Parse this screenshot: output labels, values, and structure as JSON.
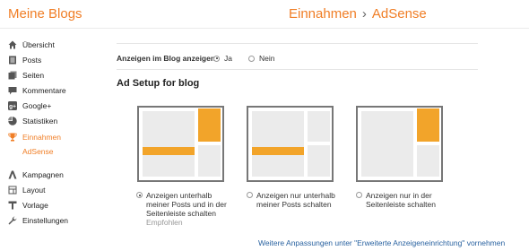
{
  "header": {
    "brand": "Meine Blogs",
    "breadcrumb_section": "Einnahmen",
    "breadcrumb_separator": "›",
    "breadcrumb_page": "AdSense"
  },
  "sidebar": {
    "items": [
      {
        "label": "Übersicht",
        "icon": "home-icon"
      },
      {
        "label": "Posts",
        "icon": "document-icon"
      },
      {
        "label": "Seiten",
        "icon": "pages-icon"
      },
      {
        "label": "Kommentare",
        "icon": "comment-icon"
      },
      {
        "label": "Google+",
        "icon": "google-plus-icon"
      },
      {
        "label": "Statistiken",
        "icon": "pie-chart-icon"
      },
      {
        "label": "Einnahmen",
        "icon": "trophy-icon",
        "active": true
      },
      {
        "label": "AdSense",
        "sub": true
      },
      {
        "label": "Kampagnen",
        "icon": "campaign-icon"
      },
      {
        "label": "Layout",
        "icon": "layout-icon"
      },
      {
        "label": "Vorlage",
        "icon": "template-icon"
      },
      {
        "label": "Einstellungen",
        "icon": "wrench-icon"
      }
    ]
  },
  "main": {
    "show_ads_label": "Anzeigen im Blog anzeigen",
    "option_yes": "Ja",
    "option_no": "Nein",
    "selected": "yes",
    "section_title": "Ad Setup for blog",
    "choices": [
      {
        "line1": "Anzeigen unterhalb",
        "line2": "meiner Posts und in der",
        "line3": "Seitenleiste schalten",
        "note": "Empfohlen",
        "selected": true
      },
      {
        "line1": "Anzeigen nur unterhalb",
        "line2": "meiner Posts schalten",
        "line3": "",
        "note": "",
        "selected": false
      },
      {
        "line1": "Anzeigen nur in der",
        "line2": "Seitenleiste schalten",
        "line3": "",
        "note": "",
        "selected": false
      }
    ],
    "footer_link": "Weitere Anpassungen unter \"Erweiterte Anzeigeneinrichtung\" vornehmen"
  },
  "colors": {
    "accent": "#f07e26",
    "ad_block": "#f2a42a",
    "link": "#2962a0"
  }
}
